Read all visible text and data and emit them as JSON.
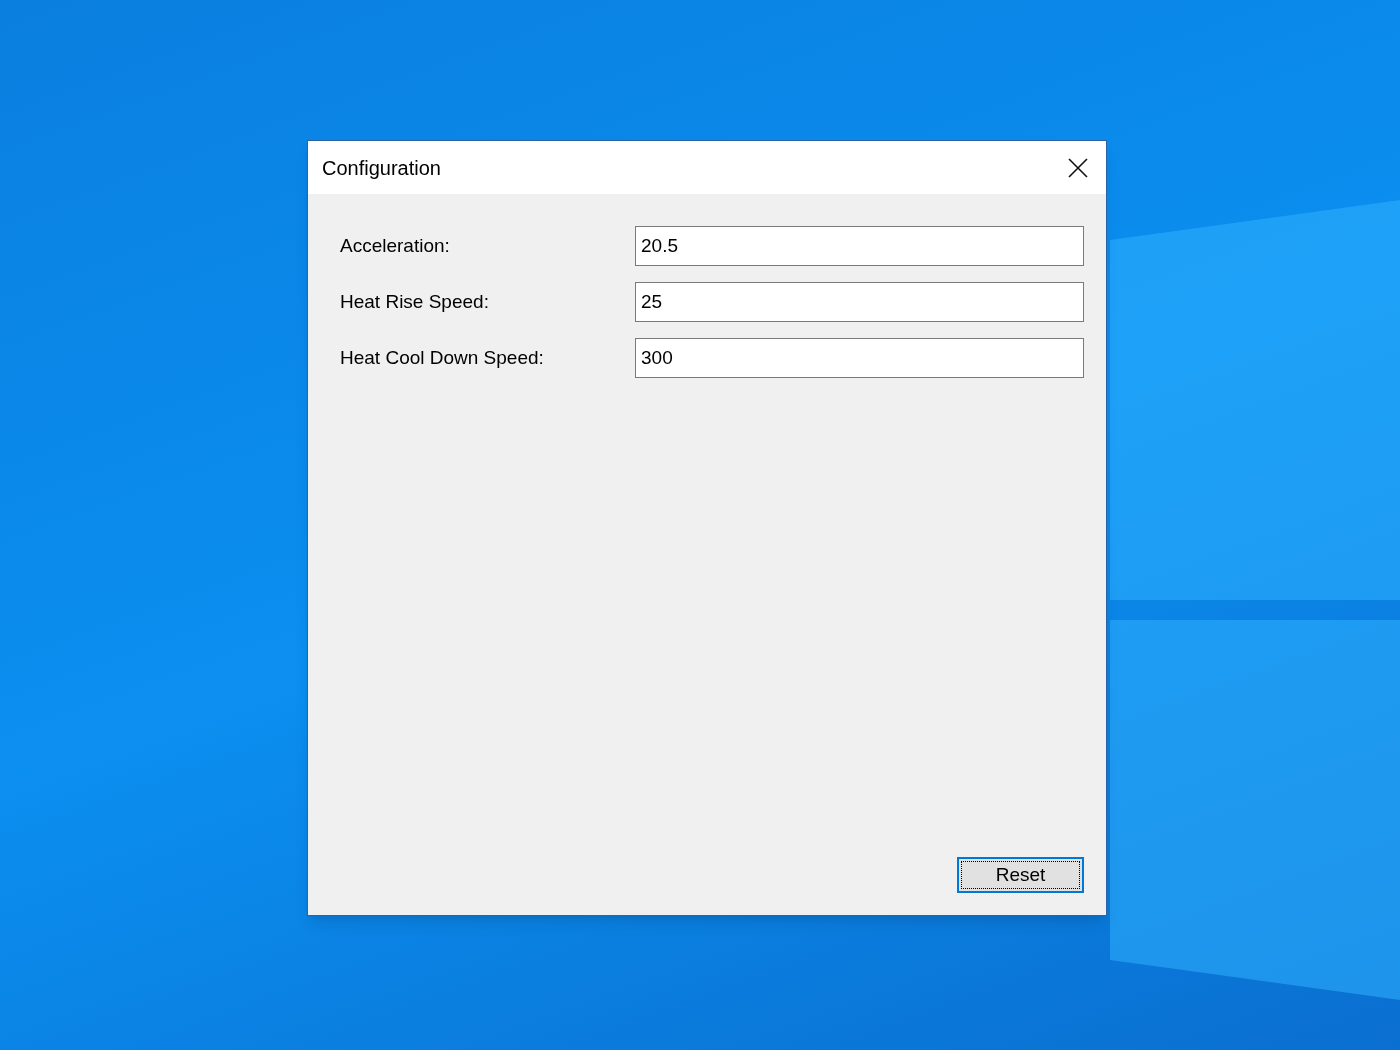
{
  "window": {
    "title": "Configuration"
  },
  "fields": [
    {
      "label": "Acceleration:",
      "value": "20.5"
    },
    {
      "label": "Heat Rise Speed:",
      "value": "25"
    },
    {
      "label": "Heat Cool Down Speed:",
      "value": "300"
    }
  ],
  "button": {
    "label": "Reset",
    "focused": true
  }
}
